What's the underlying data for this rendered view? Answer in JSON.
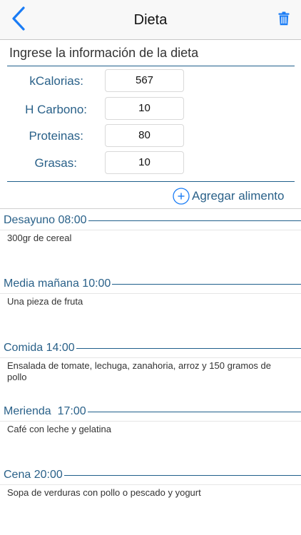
{
  "header": {
    "title": "Dieta",
    "back_icon": "chevron-left-icon",
    "delete_icon": "trash-icon",
    "accent_color": "#1a7cf5"
  },
  "form": {
    "section_title": "Ingrese la información de la dieta",
    "kcal_label": "kCalorias:",
    "kcal_value": "567",
    "carbs_label": "H Carbono:",
    "carbs_value": "10",
    "protein_label": "Proteinas:",
    "protein_value": "80",
    "fat_label": "Grasas:",
    "fat_value": "10"
  },
  "add_food": {
    "label": "Agregar alimento",
    "icon": "plus-circle-icon"
  },
  "meals": [
    {
      "title": "Desayuno 08:00",
      "content": "300gr de cereal"
    },
    {
      "title": "Media mañana 10:00",
      "content": "Una pieza de fruta"
    },
    {
      "title": "Comida 14:00",
      "content": "Ensalada de tomate, lechuga, zanahoria, arroz y 150 gramos de pollo"
    },
    {
      "title": "Merienda  17:00",
      "content": "Café con leche y gelatina"
    },
    {
      "title": "Cena 20:00",
      "content": "Sopa de verduras con pollo o pescado y yogurt"
    }
  ]
}
